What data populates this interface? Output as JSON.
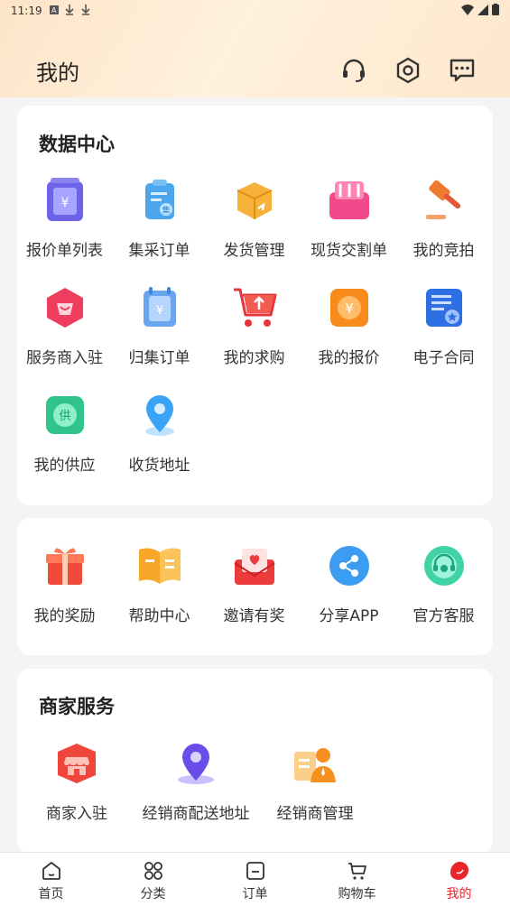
{
  "status_bar": {
    "time": "11:19"
  },
  "header": {
    "title": "我的"
  },
  "data_center": {
    "title": "数据中心",
    "items": [
      {
        "label": "报价单列表",
        "icon": "quote-list-icon"
      },
      {
        "label": "集采订单",
        "icon": "group-purchase-icon"
      },
      {
        "label": "发货管理",
        "icon": "shipping-box-icon"
      },
      {
        "label": "现货交割单",
        "icon": "spot-delivery-icon"
      },
      {
        "label": "我的竞拍",
        "icon": "auction-hammer-icon"
      },
      {
        "label": "服务商入驻",
        "icon": "service-provider-icon"
      },
      {
        "label": "归集订单",
        "icon": "collect-order-icon"
      },
      {
        "label": "我的求购",
        "icon": "purchase-cart-icon"
      },
      {
        "label": "我的报价",
        "icon": "my-quote-icon"
      },
      {
        "label": "电子合同",
        "icon": "e-contract-icon"
      },
      {
        "label": "我的供应",
        "icon": "supply-icon"
      },
      {
        "label": "收货地址",
        "icon": "location-pin-icon"
      }
    ]
  },
  "extras": {
    "items": [
      {
        "label": "我的奖励",
        "icon": "gift-icon"
      },
      {
        "label": "帮助中心",
        "icon": "help-book-icon"
      },
      {
        "label": "邀请有奖",
        "icon": "invite-envelope-icon"
      },
      {
        "label": "分享APP",
        "icon": "share-icon"
      },
      {
        "label": "官方客服",
        "icon": "customer-service-icon"
      }
    ]
  },
  "merchant": {
    "title": "商家服务",
    "items": [
      {
        "label": "商家入驻",
        "icon": "store-icon"
      },
      {
        "label": "经销商配送地址",
        "icon": "distributor-address-icon"
      },
      {
        "label": "经销商管理",
        "icon": "distributor-manage-icon"
      }
    ]
  },
  "tabbar": {
    "items": [
      {
        "label": "首页",
        "icon": "home-icon"
      },
      {
        "label": "分类",
        "icon": "category-icon"
      },
      {
        "label": "订单",
        "icon": "order-icon"
      },
      {
        "label": "购物车",
        "icon": "cart-icon"
      },
      {
        "label": "我的",
        "icon": "profile-icon",
        "active": true
      }
    ]
  },
  "colors": {
    "accent": "#e8242a",
    "header_bg": "#fde4c8"
  }
}
